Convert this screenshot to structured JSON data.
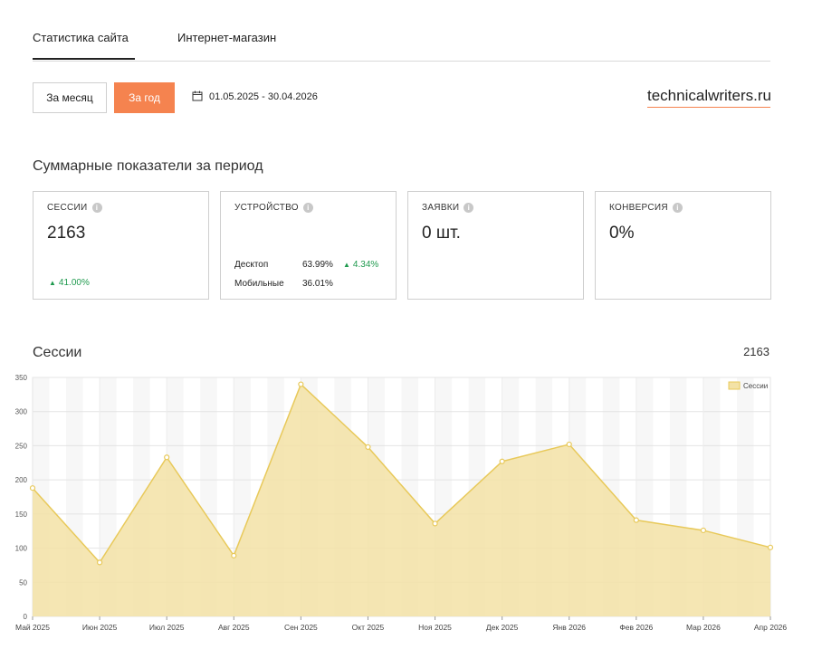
{
  "tabs": [
    {
      "label": "Статистика сайта",
      "active": true
    },
    {
      "label": "Интернет-магазин",
      "active": false
    }
  ],
  "controls": {
    "month_label": "За месяц",
    "year_label": "За год",
    "date_range": "01.05.2025 - 30.04.2026",
    "calendar_icon": "calendar-icon"
  },
  "brand": "technicalwriters.ru",
  "summary_title": "Суммарные показатели за период",
  "cards": {
    "sessions": {
      "label": "СЕССИИ",
      "value": "2163",
      "delta": "41.00%"
    },
    "device": {
      "label": "УСТРОЙСТВО",
      "rows": [
        {
          "name": "Десктоп",
          "pct": "63.99%",
          "delta": "4.34%"
        },
        {
          "name": "Мобильные",
          "pct": "36.01%"
        }
      ]
    },
    "requests": {
      "label": "ЗАЯВКИ",
      "value": "0 шт."
    },
    "conversion": {
      "label": "КОНВЕРСИЯ",
      "value": "0%"
    }
  },
  "colors": {
    "accent": "#f5834f",
    "positive": "#1f9a4e",
    "series_fill": "#f3e2a6",
    "series_line": "#e8c95a"
  },
  "chart_title": "Сессии",
  "chart_total": "2163",
  "chart_data": {
    "type": "area",
    "categories": [
      "Май 2025",
      "Июн 2025",
      "Июл 2025",
      "Авг 2025",
      "Сен 2025",
      "Окт 2025",
      "Ноя 2025",
      "Дек 2025",
      "Янв 2026",
      "Фев 2026",
      "Мар 2026",
      "Апр 2026"
    ],
    "series": [
      {
        "name": "Сессии",
        "values": [
          188,
          79,
          233,
          89,
          340,
          248,
          136,
          227,
          252,
          141,
          126,
          101
        ]
      }
    ],
    "ylim": [
      0,
      350
    ],
    "yticks": [
      0,
      50,
      100,
      150,
      200,
      250,
      300,
      350
    ],
    "grid": true,
    "legend_position": "top-right"
  }
}
